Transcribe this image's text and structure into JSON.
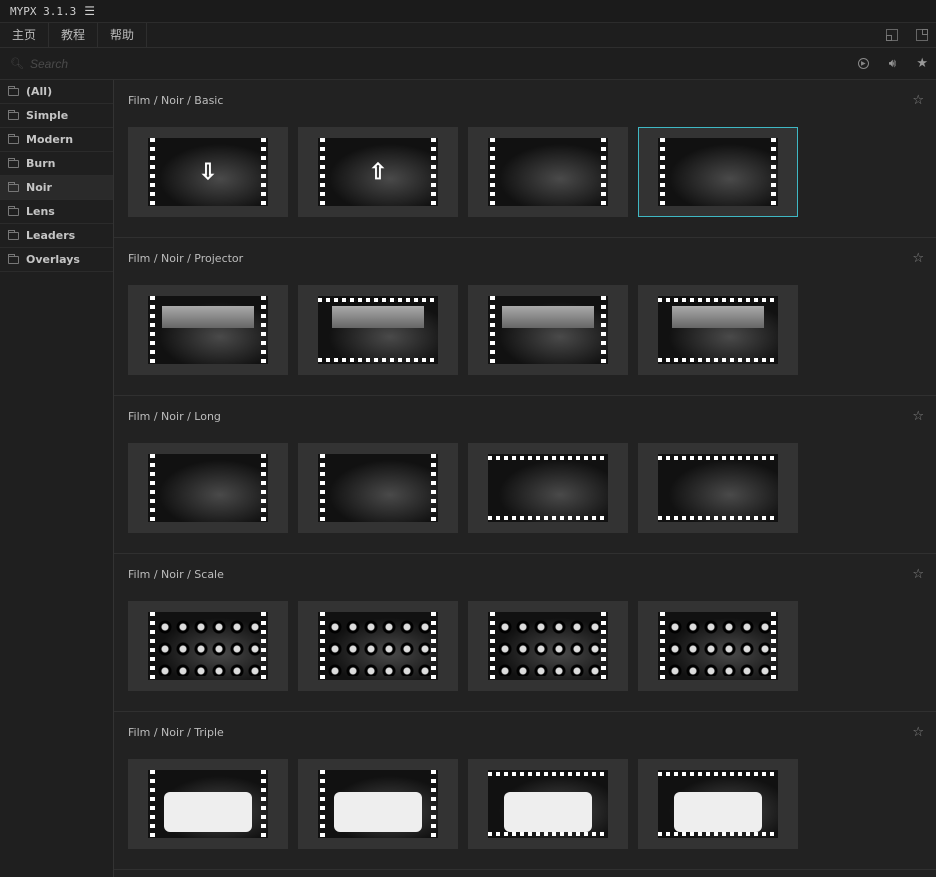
{
  "app": {
    "title": "MYPX 3.1.3",
    "menu_icon": "hamburger-icon"
  },
  "menubar": {
    "tabs": [
      "主页",
      "教程",
      "帮助"
    ]
  },
  "search": {
    "placeholder": "Search"
  },
  "sidebar": {
    "items": [
      {
        "label": "(All)"
      },
      {
        "label": "Simple"
      },
      {
        "label": "Modern"
      },
      {
        "label": "Burn"
      },
      {
        "label": "Noir",
        "active": true
      },
      {
        "label": "Lens"
      },
      {
        "label": "Leaders"
      },
      {
        "label": "Overlays"
      }
    ]
  },
  "colors": {
    "accent": "#3fb8c4",
    "background": "#222222",
    "card": "#333333"
  },
  "sections": [
    {
      "title": "Film / Noir / Basic",
      "style": "basic",
      "selected_index": 3
    },
    {
      "title": "Film / Noir / Projector",
      "style": "projector",
      "selected_index": -1
    },
    {
      "title": "Film / Noir / Long",
      "style": "long",
      "selected_index": -1
    },
    {
      "title": "Film / Noir / Scale",
      "style": "scale",
      "selected_index": -1
    },
    {
      "title": "Film / Noir / Triple",
      "style": "triple",
      "selected_index": -1
    }
  ]
}
